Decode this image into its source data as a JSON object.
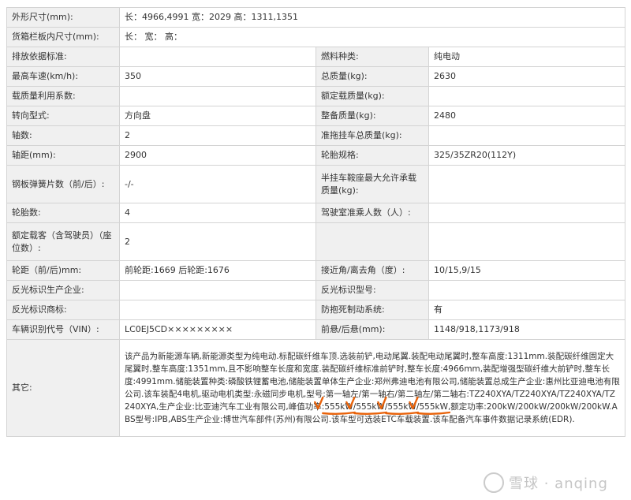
{
  "rows": [
    {
      "type": "wide",
      "label": "外形尺寸(mm):",
      "value": "长：4966,4991 宽：2029 高：1311,1351"
    },
    {
      "type": "wide",
      "label": "货箱栏板内尺寸(mm):",
      "value": "长：  宽：  高："
    },
    {
      "type": "pair",
      "l1": "排放依据标准:",
      "v1": "",
      "l2": "燃料种类:",
      "v2": "纯电动"
    },
    {
      "type": "pair",
      "l1": "最高车速(km/h):",
      "v1": "350",
      "l2": "总质量(kg):",
      "v2": "2630"
    },
    {
      "type": "pair",
      "l1": "载质量利用系数:",
      "v1": "",
      "l2": "额定载质量(kg):",
      "v2": ""
    },
    {
      "type": "pair",
      "l1": "转向型式:",
      "v1": "方向盘",
      "l2": "整备质量(kg):",
      "v2": "2480"
    },
    {
      "type": "pair",
      "l1": "轴数:",
      "v1": "2",
      "l2": "准拖挂车总质量(kg):",
      "v2": ""
    },
    {
      "type": "pair",
      "l1": "轴距(mm):",
      "v1": "2900",
      "l2": "轮胎规格:",
      "v2": "325/35ZR20(112Y)"
    },
    {
      "type": "pair",
      "l1": "钢板弹簧片数（前/后）:",
      "v1": "-/-",
      "l2": "半挂车鞍座最大允许承载质量(kg):",
      "v2": ""
    },
    {
      "type": "pair",
      "l1": "轮胎数:",
      "v1": "4",
      "l2": "驾驶室准乘人数（人）:",
      "v2": ""
    },
    {
      "type": "pair",
      "l1": "额定载客（含驾驶员）（座位数）:",
      "v1": "2",
      "l2": "",
      "v2": ""
    },
    {
      "type": "pair",
      "l1": "轮距（前/后)mm:",
      "v1": "前轮距:1669 后轮距:1676",
      "l2": "接近角/离去角（度）:",
      "v2": "10/15,9/15"
    },
    {
      "type": "pair",
      "l1": "反光标识生产企业:",
      "v1": "",
      "l2": "反光标识型号:",
      "v2": ""
    },
    {
      "type": "pair",
      "l1": "反光标识商标:",
      "v1": "",
      "l2": "防抱死制动系统:",
      "v2": "有"
    },
    {
      "type": "pair",
      "l1": "车辆识别代号（VIN）:",
      "v1": "LC0EJ5CD×××××××××",
      "l2": "前悬/后悬(mm):",
      "v2": "1148/918,1173/918"
    }
  ],
  "other": {
    "label": "其它:",
    "text_before": "该产品为新能源车辆,新能源类型为纯电动.标配碳纤维车顶.选装前铲,电动尾翼.装配电动尾翼时,整车高度:1311mm.装配碳纤维固定大尾翼时,整车高度:1351mm,且不影响整车长度和宽度.装配碳纤维标准前铲时,整车长度:4966mm,装配增强型碳纤维大前铲时,整车长度:4991mm.储能装置种类:磷酸铁锂蓄电池,储能装置单体生产企业:郑州弗迪电池有限公司,储能装置总成生产企业:惠州比亚迪电池有限公司.该车装配4电机,驱动电机类型:永磁同步电机,型号:第一轴左/第一轴右/第二轴左/第二轴右:TZ240XYA/TZ240XYA/TZ240XYA/TZ240XYA,生产企业:比亚迪汽车工业有限公司,峰值功率:",
    "power_values": [
      "555kW",
      "555kW",
      "555kW",
      "555kW"
    ],
    "text_after": ",额定功率:200kW/200kW/200kW/200kW.ABS型号:IPB,ABS生产企业:博世汽车部件(苏州)有限公司.该车型可选装ETC车载装置.该车配备汽车事件数据记录系统(EDR)."
  },
  "watermark": {
    "text": "雪球 · anqing"
  },
  "colors": {
    "annotation": "#e8620a",
    "label_bg": "#f0f0f0",
    "border": "#d4d4d4"
  }
}
